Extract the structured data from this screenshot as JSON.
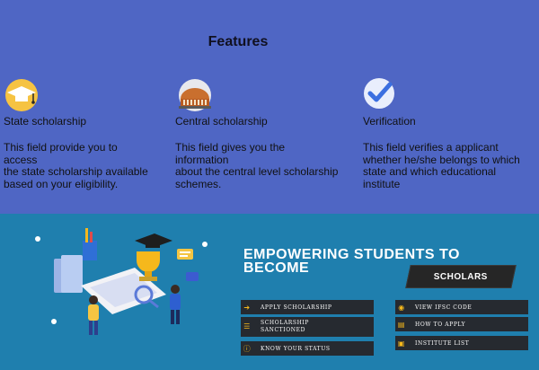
{
  "features": {
    "title": "Features",
    "items": [
      {
        "icon": "graduation-cap-icon",
        "title": "State  scholarship",
        "desc_lines": [
          "This field provide you to",
          "access",
          "the state scholarship available",
          "based on your eligibility."
        ]
      },
      {
        "icon": "parliament-building-icon",
        "title": "Central  scholarship",
        "desc_lines": [
          "This field gives you the",
          "information",
          "about the central level scholarship",
          "schemes."
        ]
      },
      {
        "icon": "checkmark-badge-icon",
        "title": "Verification",
        "desc_lines": [
          "This field verifies a applicant",
          "whether he/she belongs to which",
          "state and which educational",
          "institute"
        ]
      }
    ]
  },
  "banner": {
    "title_line1": "EMPOWERING STUDENTS TO",
    "title_line2": "BECOME",
    "highlight": "SCHOLARS",
    "buttons_left": [
      {
        "label": "APPLY SCHOLARSHIP",
        "icon": "arrow-icon"
      },
      {
        "label_line1": "SCHOLARSHIP",
        "label_line2": "SANCTIONED",
        "icon": "list-icon"
      },
      {
        "label": "KNOW YOUR STATUS",
        "icon": "info-icon"
      }
    ],
    "buttons_right": [
      {
        "label": "VIEW IFSC CODE",
        "icon": "eye-icon"
      },
      {
        "label": "HOW TO APPLY",
        "icon": "form-icon"
      },
      {
        "label": "INSTITUTE LIST",
        "icon": "document-icon"
      }
    ]
  },
  "colors": {
    "features_bg": "#4f66c4",
    "banner_bg": "#1f7fae",
    "accent": "#f5b81c",
    "button_bg": "#262a30"
  }
}
